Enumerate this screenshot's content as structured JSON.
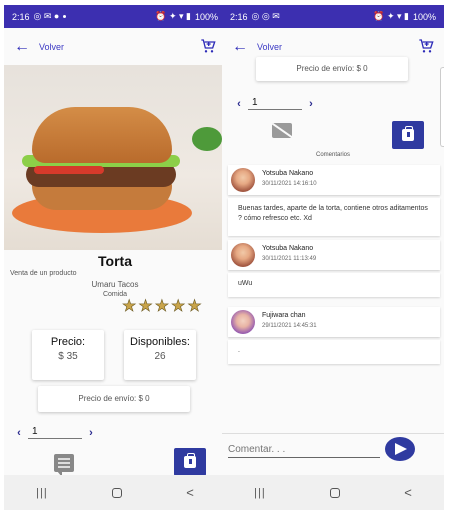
{
  "left": {
    "status": {
      "time": "2:16",
      "battery": "100%"
    },
    "header": {
      "back_label": "Volver"
    },
    "product": {
      "title": "Torta",
      "sell_type": "Venta de un producto",
      "shop": "Umaru Tacos",
      "category": "Comida",
      "rating": 5
    },
    "price": {
      "label": "Precio:",
      "value": "$ 35"
    },
    "stock": {
      "label": "Disponibles:",
      "value": "26"
    },
    "shipping": "Precio de envío: $ 0",
    "quantity": "1",
    "nav": {
      "recents": "|||",
      "home": "",
      "back": "<"
    }
  },
  "right": {
    "status": {
      "time": "2:16",
      "battery": "100%"
    },
    "header": {
      "back_label": "Volver"
    },
    "shipping": "Precio de envío: $ 0",
    "quantity": "1",
    "comments_heading": "Comentarios",
    "comments": [
      {
        "author": "Yotsuba Nakano",
        "date": "30/11/2021 14:16:10",
        "text": "Buenas tardes, aparte de la torta, contiene otros aditamentos ? cómo refresco etc. Xd"
      },
      {
        "author": "Yotsuba Nakano",
        "date": "30/11/2021 11:13:49",
        "text": "uWu"
      },
      {
        "author": "Fujiwara chan",
        "date": "29/11/2021 14:45:31",
        "text": "."
      }
    ],
    "composer": {
      "placeholder": "Comentar. . ."
    },
    "nav": {
      "recents": "|||",
      "home": "",
      "back": "<"
    }
  },
  "colors": {
    "primary": "#3c2fb0",
    "accent": "#2f3aa0",
    "star": "#c9a44a"
  }
}
